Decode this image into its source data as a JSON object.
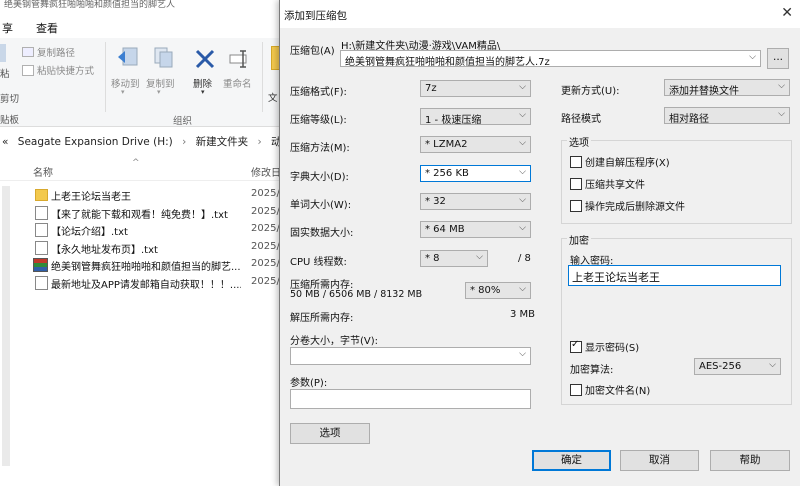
{
  "explorer": {
    "title_fragment": "绝美钢管舞疯狂啪啪啪和颜值担当的脚艺人",
    "menu": [
      "享",
      "查看"
    ],
    "ribbon": {
      "copy_path": "复制路径",
      "paste_shortcut": "粘贴快捷方式",
      "paste_fragment": "粘",
      "cut_fragment": "剪切",
      "board_fragment": "贴板",
      "move_to": "移动到",
      "copy_to": "复制到",
      "delete": "删除",
      "rename": "重命名",
      "new_fragment": "文",
      "organize": "组织"
    },
    "breadcrumb": [
      "«",
      "Seagate Expansion Drive (H:)",
      "›",
      "新建文件夹",
      "›",
      "动漫·游戏"
    ],
    "columns": {
      "name": "名称",
      "modified": "修改日"
    },
    "files": [
      {
        "name": "上老王论坛当老王",
        "date": "2025/",
        "icon": "folder-icon"
      },
      {
        "name": "【来了就能下载和观看！纯免费！】.txt",
        "date": "2025/",
        "icon": "text-file-icon"
      },
      {
        "name": "【论坛介绍】.txt",
        "date": "2025/",
        "icon": "text-file-icon"
      },
      {
        "name": "【永久地址发布页】.txt",
        "date": "2025/",
        "icon": "text-file-icon"
      },
      {
        "name": "绝美钢管舞疯狂啪啪啪和颜值担当的脚艺...",
        "date": "2025/",
        "icon": "archive-icon"
      },
      {
        "name": "最新地址及APP请发邮箱自动获取！！！....",
        "date": "2025/",
        "icon": "text-file-icon"
      }
    ]
  },
  "dialog": {
    "title": "添加到压缩包",
    "close": "✕",
    "archive_label": "压缩包(A)",
    "archive_path": "H:\\新建文件夹\\动漫·游戏\\VAM精品\\",
    "archive_name": "绝美钢管舞疯狂啪啪啪和颜值担当的脚艺人.7z",
    "browse": "...",
    "format_label": "压缩格式(F):",
    "format_value": "7z",
    "level_label": "压缩等级(L):",
    "level_value": "1 - 极速压缩",
    "method_label": "压缩方法(M):",
    "method_value": "* LZMA2",
    "dict_label": "字典大小(D):",
    "dict_value": "* 256 KB",
    "word_label": "单词大小(W):",
    "word_value": "* 32",
    "solid_label": "固实数据大小:",
    "solid_value": "* 64 MB",
    "threads_label": "CPU 线程数:",
    "threads_value": "* 8",
    "threads_max": "/ 8",
    "mem_comp_label": "压缩所需内存:",
    "mem_comp_value": "50 MB / 6506 MB / 8132 MB",
    "mem_percent": "* 80%",
    "mem_decomp_label": "解压所需内存:",
    "mem_decomp_value": "3 MB",
    "split_label": "分卷大小，字节(V):",
    "split_value": "",
    "params_label": "参数(P):",
    "params_value": "",
    "options_button": "选项",
    "update_label": "更新方式(U):",
    "update_value": "添加并替换文件",
    "path_label": "路径模式",
    "path_value": "相对路径",
    "options_group": "选项",
    "opt_sfx": "创建自解压程序(X)",
    "opt_shared": "压缩共享文件",
    "opt_delete": "操作完成后删除源文件",
    "enc_group": "加密",
    "pwd_label": "输入密码:",
    "pwd_value": "上老王论坛当老王",
    "show_pwd": "显示密码(S)",
    "enc_method_label": "加密算法:",
    "enc_method_value": "AES-256",
    "enc_names": "加密文件名(N)",
    "ok": "确定",
    "cancel": "取消",
    "help": "帮助"
  }
}
